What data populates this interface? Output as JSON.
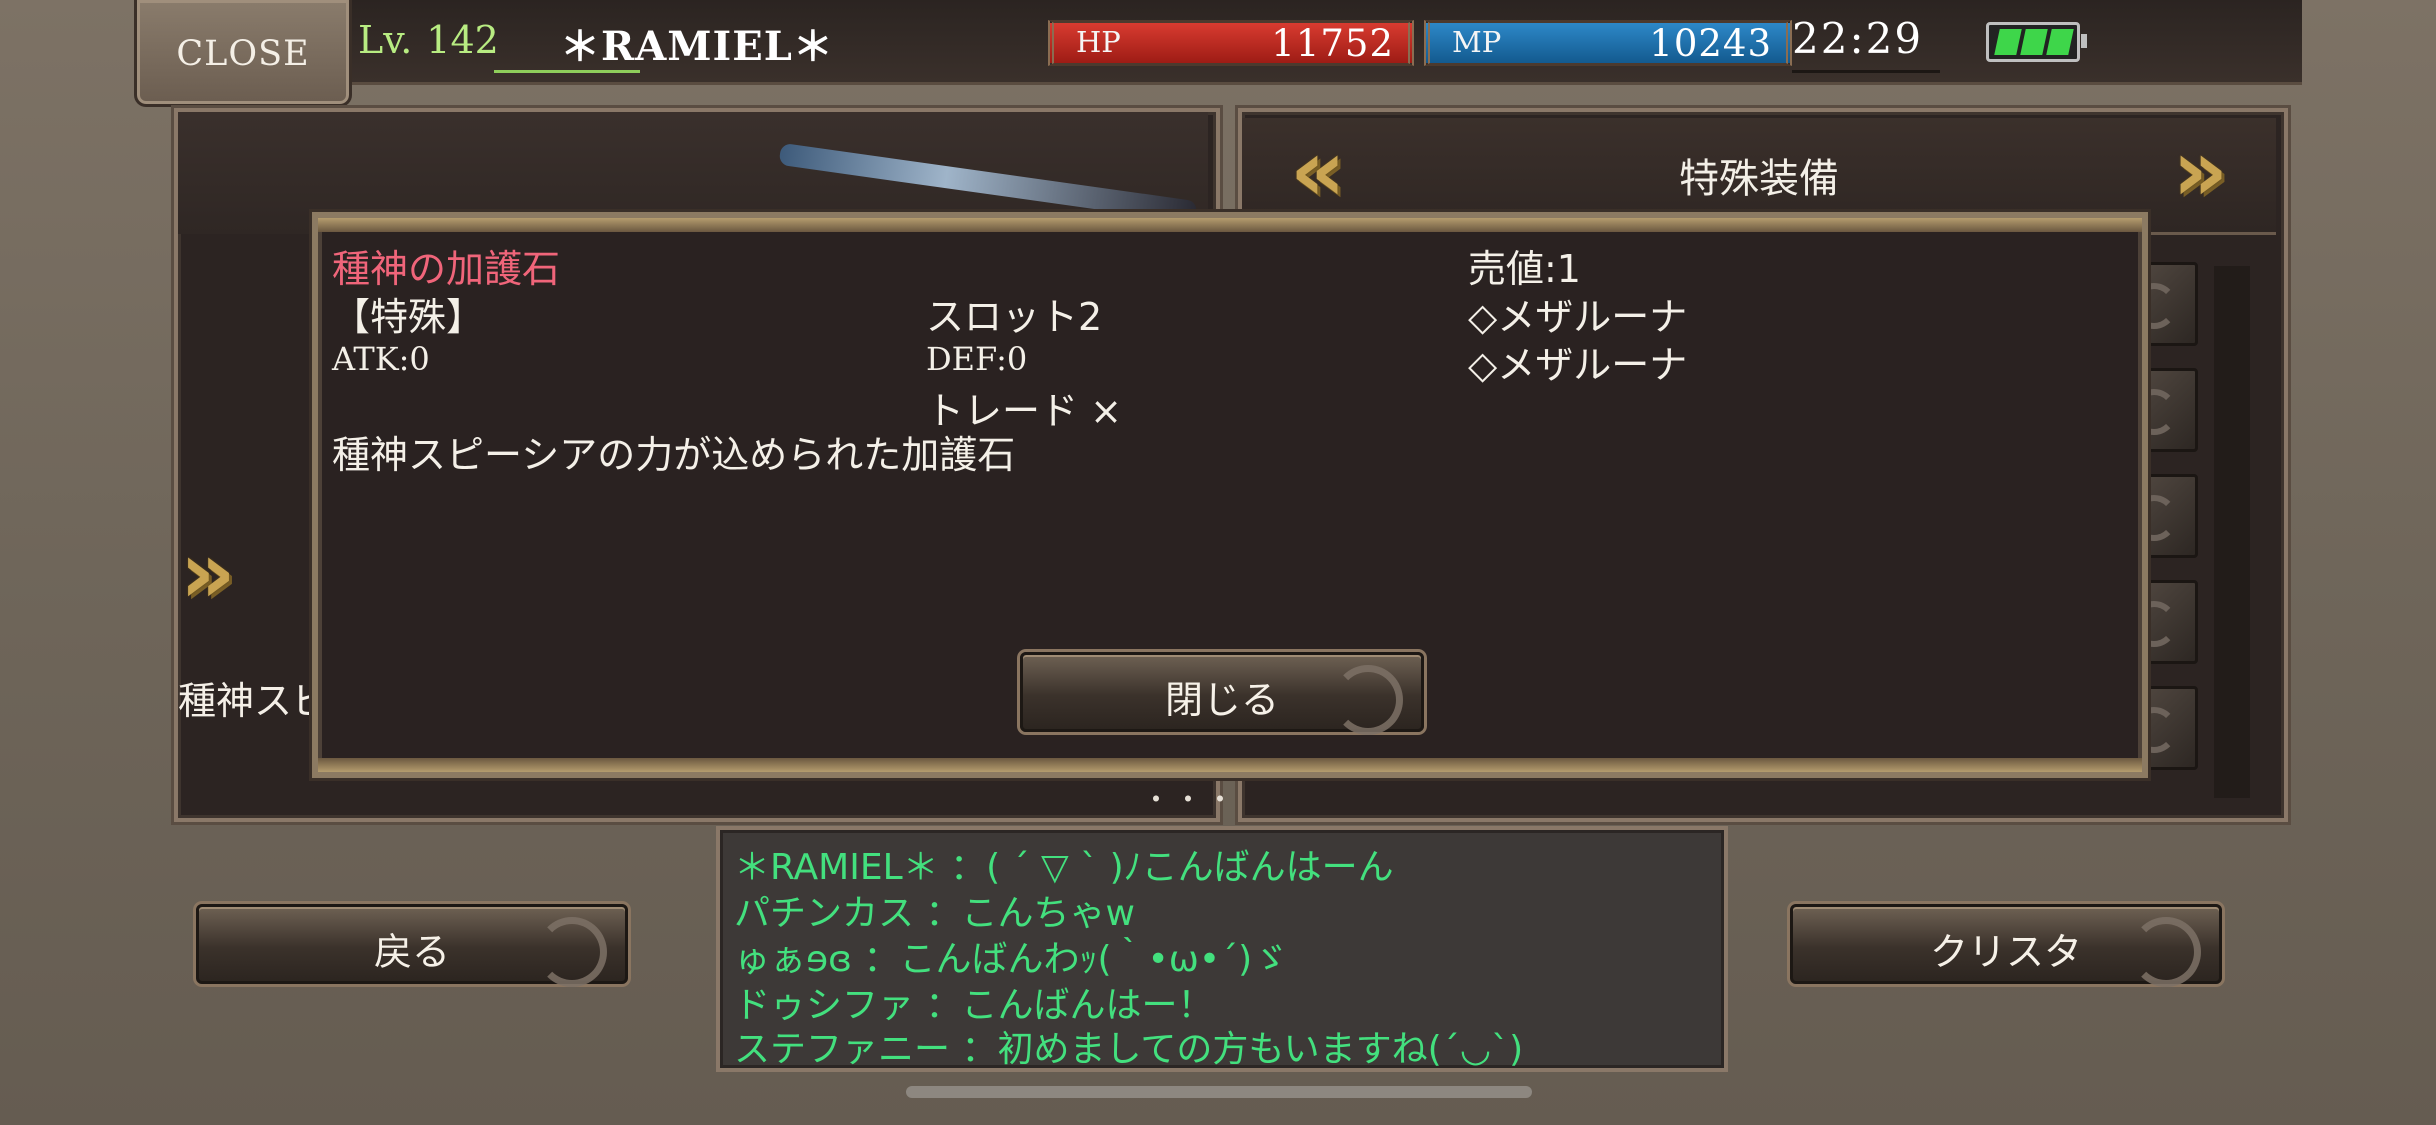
{
  "status_bar": {
    "close_label": "CLOSE",
    "level_prefix": "Lv.",
    "level_value": "142",
    "player_name": "＊RAMIEL＊",
    "hp_label": "HP",
    "hp_value": "11752",
    "mp_label": "MP",
    "mp_value": "10243",
    "clock": "22:29"
  },
  "right_panel": {
    "title": "特殊装備"
  },
  "left_panel": {
    "item_caption": "種神スピ",
    "more_indicator": "・・・"
  },
  "item_dialog": {
    "name": "種神の加護石",
    "category": "【特殊】",
    "slot": "スロット2",
    "atk": "ATK:0",
    "def": "DEF:0",
    "trade": "トレード ×",
    "sell_value": "売値:1",
    "socket_1": "◇メザルーナ",
    "socket_2": "◇メザルーナ",
    "description": "種神スピーシアの力が込められた加護石",
    "close_button": "閉じる"
  },
  "buttons": {
    "back": "戻る",
    "crysta": "クリスタ"
  },
  "chat": {
    "messages": [
      "＊RAMIEL＊ ：( ´ ▽ ` )ﾉこんばんはーん",
      "パチンカス ：こんちゃw",
      "ゅぁɘɞ ：こんばんわｯ(｀•ω•´)ゞ",
      "ドゥシファ ：こんばんはー！",
      "ステファニー ：初めましての方もいますね(´◡`)"
    ]
  },
  "colors": {
    "name_pink": "#f0657a",
    "chat_green": "#43e07e",
    "level_green": "#b8ec82",
    "hp_red": "#d83b30",
    "mp_blue": "#2d88c8",
    "chevron_gold": "#c9a452"
  },
  "icons": {
    "battery": "battery-icon",
    "prev": "double-chevron-left-icon",
    "next": "double-chevron-right-icon",
    "swirl": "swirl-ornament-icon"
  }
}
